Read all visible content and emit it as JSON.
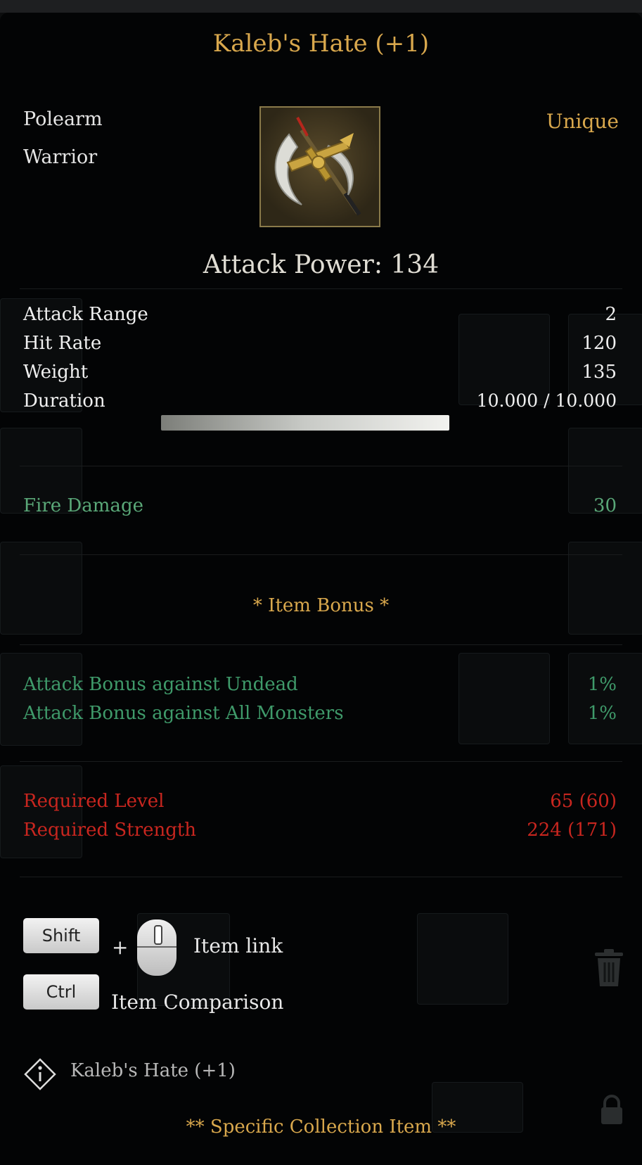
{
  "item": {
    "name": "Kaleb's Hate (+1)",
    "type": "Polearm",
    "class": "Warrior",
    "rarity": "Unique",
    "icon": "polearm-axe-icon",
    "attack_power": "Attack Power: 134"
  },
  "stats": [
    {
      "label": "Attack Range",
      "value": "2"
    },
    {
      "label": "Hit Rate",
      "value": "120"
    },
    {
      "label": "Weight",
      "value": "135"
    },
    {
      "label": "Duration",
      "value": "10.000 / 10.000"
    }
  ],
  "duration_fraction": 1.0,
  "elemental": {
    "label": "Fire Damage",
    "value": "30"
  },
  "bonus_section": {
    "title": "*  Item Bonus *",
    "entries": [
      {
        "label": "Attack Bonus against Undead",
        "value": "1%"
      },
      {
        "label": "Attack Bonus against All Monsters",
        "value": "1%"
      }
    ]
  },
  "requirements": [
    {
      "label": "Required Level",
      "value": "65 (60)"
    },
    {
      "label": "Required Strength",
      "value": "224 (171)"
    }
  ],
  "hints": {
    "shift_key": "Shift",
    "plus": "+",
    "item_link": "Item link",
    "ctrl_key": "Ctrl",
    "item_comparison": "Item Comparison"
  },
  "footer": {
    "info_name": "Kaleb's Hate (+1)",
    "collection": "** Specific Collection Item **"
  },
  "colors": {
    "gold": "#d9a84d",
    "green": "#5aa878",
    "red": "#c8261f"
  }
}
